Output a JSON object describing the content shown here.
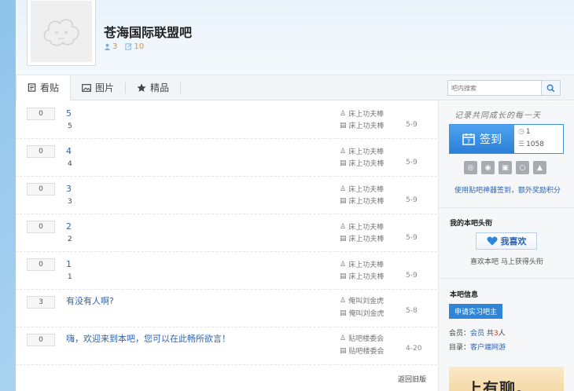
{
  "forum": {
    "name": "苍海国际联盟吧",
    "members": "3",
    "posts": "10"
  },
  "nav": {
    "tabs": [
      {
        "label": "看贴"
      },
      {
        "label": "图片"
      },
      {
        "label": "精品"
      }
    ],
    "search_placeholder": "吧内搜索"
  },
  "threads": [
    {
      "replies": "0",
      "title": "5",
      "abstract": "5",
      "author": "床上功夫棒",
      "last_reply_user": "床上功夫棒",
      "date": "5-9"
    },
    {
      "replies": "0",
      "title": "4",
      "abstract": "4",
      "author": "床上功夫棒",
      "last_reply_user": "床上功夫棒",
      "date": "5-9"
    },
    {
      "replies": "0",
      "title": "3",
      "abstract": "3",
      "author": "床上功夫棒",
      "last_reply_user": "床上功夫棒",
      "date": "5-9"
    },
    {
      "replies": "0",
      "title": "2",
      "abstract": "2",
      "author": "床上功夫棒",
      "last_reply_user": "床上功夫棒",
      "date": "5-9"
    },
    {
      "replies": "0",
      "title": "1",
      "abstract": "1",
      "author": "床上功夫棒",
      "last_reply_user": "床上功夫棒",
      "date": "5-9"
    },
    {
      "replies": "3",
      "title": "有没有人啊?",
      "abstract": "",
      "author": "俺叫刘金虎",
      "last_reply_user": "俺叫刘金虎",
      "date": "5-8"
    },
    {
      "replies": "0",
      "title": "嗨，欢迎来到本吧，您可以在此畅所欲言！",
      "abstract": "",
      "author": "贴吧楼委会",
      "last_reply_user": "贴吧楼委会",
      "date": "4-20"
    }
  ],
  "pager": {
    "back_label": "返回旧版"
  },
  "sidebar": {
    "motto": "记录共同成长的每一天",
    "signin_label": "签到",
    "signin_days": "1",
    "signin_total": "1058",
    "tool_link": "使用贴吧神器签到，额外奖励积分",
    "head_title": "我的本吧头衔",
    "like_label": "我喜欢",
    "like_tip": "喜欢本吧 马上获得头衔",
    "info_title": "本吧信息",
    "apply_label": "申请实习吧主",
    "members_label": "会员：",
    "members_link": "会员",
    "members_total_prefix": "共",
    "members_total": "3",
    "members_total_suffix": "人",
    "dir_label": "目录：",
    "dir_link": "客户端网游",
    "ad_text": "上有聊。"
  },
  "colors": {
    "link": "#2d64b3",
    "accent": "#2f86d8",
    "stat_orange": "#f08a24"
  }
}
